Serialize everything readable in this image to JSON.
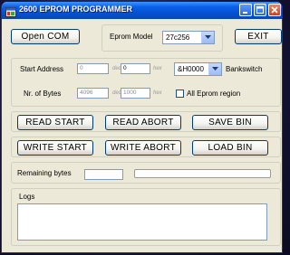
{
  "window": {
    "title": "2600 EPROM PROGRAMMER",
    "icons": {
      "app": "app-icon",
      "minimize": "minimize-icon",
      "maximize": "maximize-icon",
      "close": "close-icon"
    }
  },
  "top": {
    "open_com_label": "Open COM",
    "eprom_model_label": "Eprom Model",
    "eprom_model_value": "27c256",
    "exit_label": "EXIT"
  },
  "address": {
    "start_address_label": "Start Address",
    "start_dec_value": "0",
    "dec_unit": "dec",
    "start_hex_value": "0",
    "hex_unit": "hex",
    "bankswitch_value": "&H0000",
    "bankswitch_label": "Bankswitch",
    "nr_bytes_label": "Nr. of Bytes",
    "bytes_dec_value": "4096",
    "bytes_hex_value": "1000",
    "all_eprom_label": "All Eprom region",
    "all_eprom_checked": false
  },
  "read": {
    "start_label": "READ START",
    "abort_label": "READ ABORT",
    "save_label": "SAVE BIN"
  },
  "write": {
    "start_label": "WRITE START",
    "abort_label": "WRITE ABORT",
    "load_label": "LOAD BIN"
  },
  "progress": {
    "remaining_label": "Remaining bytes",
    "remaining_value": "",
    "progress_fraction": 0
  },
  "logs": {
    "label": "Logs",
    "content": ""
  }
}
